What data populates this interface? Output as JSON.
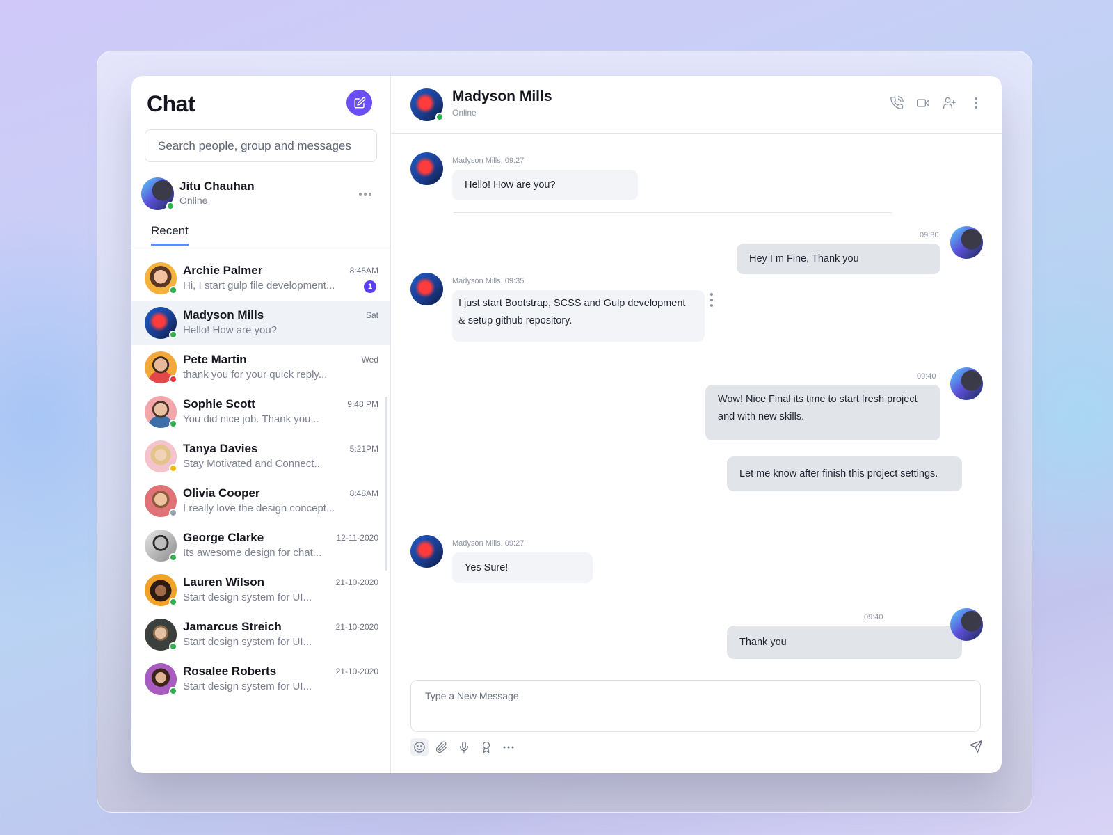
{
  "sidebar": {
    "title": "Chat",
    "compose_icon": "edit-icon",
    "search_placeholder": "Search people, group and messages",
    "current_user": {
      "name": "Jitu Chauhan",
      "status": "Online",
      "status_color": "#2fb04e"
    },
    "tabs": [
      {
        "label": "Recent",
        "active": true
      }
    ],
    "conversations": [
      {
        "name": "Archie Palmer",
        "preview": "Hi, I start gulp file development...",
        "time": "8:48AM",
        "unread": "1",
        "status_color": "#2fb04e"
      },
      {
        "name": "Madyson Mills",
        "preview": "Hello! How are you?",
        "time": "Sat",
        "unread": null,
        "status_color": "#2fb04e",
        "active": true
      },
      {
        "name": "Pete Martin",
        "preview": "thank you for your quick reply...",
        "time": "Wed",
        "unread": null,
        "status_color": "#e5353b"
      },
      {
        "name": "Sophie Scott",
        "preview": "You did nice job. Thank you...",
        "time": "9:48 PM",
        "unread": null,
        "status_color": "#2fb04e"
      },
      {
        "name": "Tanya Davies",
        "preview": "Stay Motivated and Connect..",
        "time": "5:21PM",
        "unread": null,
        "status_color": "#f5b800"
      },
      {
        "name": "Olivia Cooper",
        "preview": "I really love the design concept...",
        "time": "8:48AM",
        "unread": null,
        "status_color": "#9aa0ad"
      },
      {
        "name": "George Clarke",
        "preview": "Its awesome design for chat...",
        "time": "12-11-2020",
        "unread": null,
        "status_color": "#2fb04e"
      },
      {
        "name": "Lauren Wilson",
        "preview": "Start design system for UI...",
        "time": "21-10-2020",
        "unread": null,
        "status_color": "#2fb04e"
      },
      {
        "name": "Jamarcus Streich",
        "preview": "Start design system for UI...",
        "time": "21-10-2020",
        "unread": null,
        "status_color": "#2fb04e"
      },
      {
        "name": "Rosalee Roberts",
        "preview": "Start design system for UI...",
        "time": "21-10-2020",
        "unread": null,
        "status_color": "#2fb04e"
      }
    ]
  },
  "chat": {
    "contact": {
      "name": "Madyson Mills",
      "status": "Online"
    },
    "header_icons": [
      "phone-call-icon",
      "video-camera-icon",
      "add-user-icon",
      "more-vertical-icon"
    ],
    "messages": [
      {
        "direction": "in",
        "meta": "Madyson Mills, 09:27",
        "text": "Hello! How are you?"
      },
      {
        "direction": "out",
        "meta": "09:30",
        "text": "Hey I m Fine, Thank you"
      },
      {
        "direction": "in",
        "meta": "Madyson Mills, 09:35",
        "text_lines": [
          "I just start Bootstrap, SCSS and Gulp development",
          "& setup github repository."
        ]
      },
      {
        "direction": "out",
        "meta": "09:40",
        "text_lines": [
          "Wow! Nice  Final its time to start fresh project",
          "and with new skills."
        ]
      },
      {
        "direction": "out",
        "meta": "",
        "text": "Let me know after finish this project settings."
      },
      {
        "direction": "in",
        "meta": "Madyson Mills, 09:27",
        "text": "Yes Sure!"
      },
      {
        "direction": "out",
        "meta": "09:40",
        "text": "Thank you"
      }
    ],
    "composer": {
      "placeholder": "Type a New Message",
      "tools": [
        "emoji-icon",
        "attachment-icon",
        "microphone-icon",
        "award-icon",
        "more-horizontal-icon"
      ],
      "send_icon": "send-icon"
    }
  },
  "colors": {
    "accent": "#6c4ef5",
    "badge": "#5b3ef0",
    "tab_underline": "#5b8def",
    "online": "#2fb04e",
    "busy": "#e5353b",
    "away": "#f5b800",
    "offline": "#9aa0ad",
    "incoming_bubble": "#f3f4f7",
    "outgoing_bubble": "#e1e4e9"
  }
}
